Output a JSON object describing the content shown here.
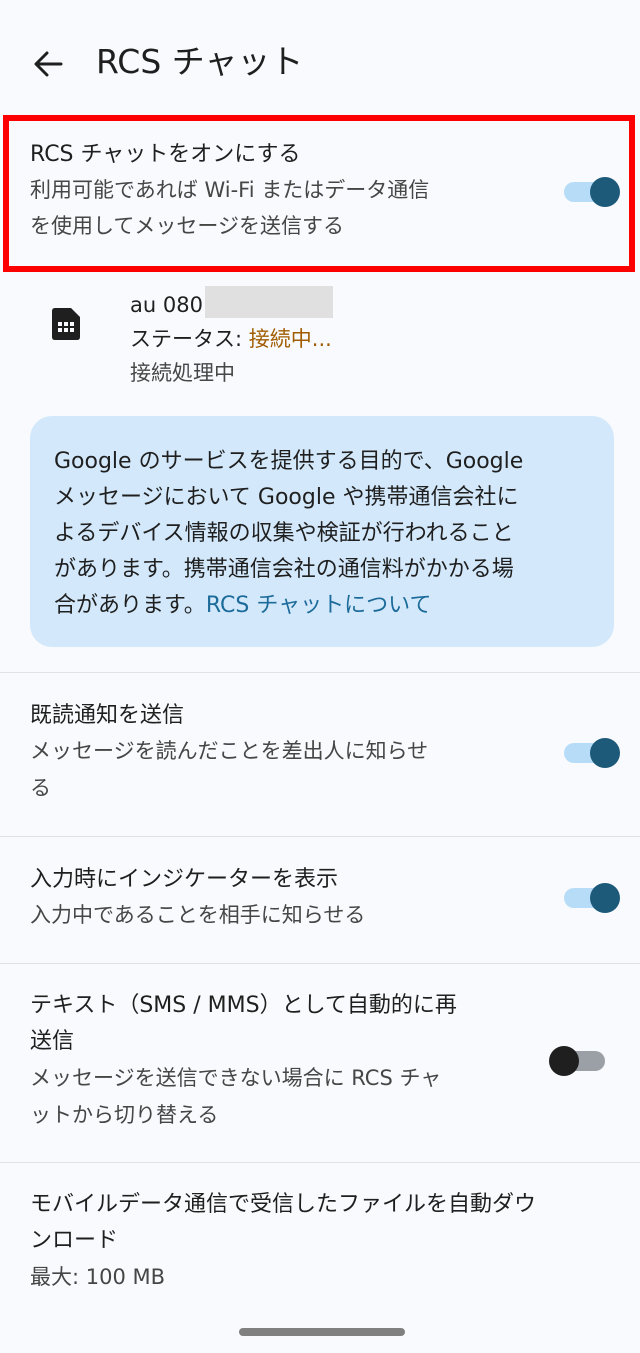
{
  "header": {
    "title": "RCS チャット"
  },
  "rcs_toggle": {
    "title": "RCS チャットをオンにする",
    "subtitle_line1": "利用可能であれば Wi-Fi またはデータ通信",
    "subtitle_line2": "を使用してメッセージを送信する",
    "on": true
  },
  "sim": {
    "carrier": "au 080",
    "status_label": "ステータス: ",
    "status_value": "接続中...",
    "detail": "接続処理中"
  },
  "info_card": {
    "line1": "Google のサービスを提供する目的で、Google",
    "line2": "メッセージにおいて Google や携帯通信会社に",
    "line3": "よるデバイス情報の収集や検証が行われること",
    "line4": "があります。携帯通信会社の通信料がかかる場",
    "line5": "合があります。",
    "link": "RCS チャットについて"
  },
  "read_receipts": {
    "title": "既読通知を送信",
    "subtitle_line1": "メッセージを読んだことを差出人に知らせ",
    "subtitle_line2": "る",
    "on": true
  },
  "typing_indicator": {
    "title": "入力時にインジケーターを表示",
    "subtitle": "入力中であることを相手に知らせる",
    "on": true
  },
  "sms_fallback": {
    "title_line1": "テキスト（SMS / MMS）として自動的に再",
    "title_line2": "送信",
    "subtitle_line1": "メッセージを送信できない場合に RCS チャ",
    "subtitle_line2": "ットから切り替える",
    "on": false
  },
  "auto_download": {
    "title_line1": "モバイルデータ通信で受信したファイルを自動ダウ",
    "title_line2": "ンロード",
    "subtitle": "最大: 100 MB"
  },
  "colors": {
    "background": "#f8fafd",
    "toggle_on_thumb": "#1d5a7a",
    "toggle_on_track": "#b6dcf7",
    "info_card": "#d3e9fb",
    "status_connecting": "#a15c00",
    "highlight_border": "#ff0000"
  }
}
